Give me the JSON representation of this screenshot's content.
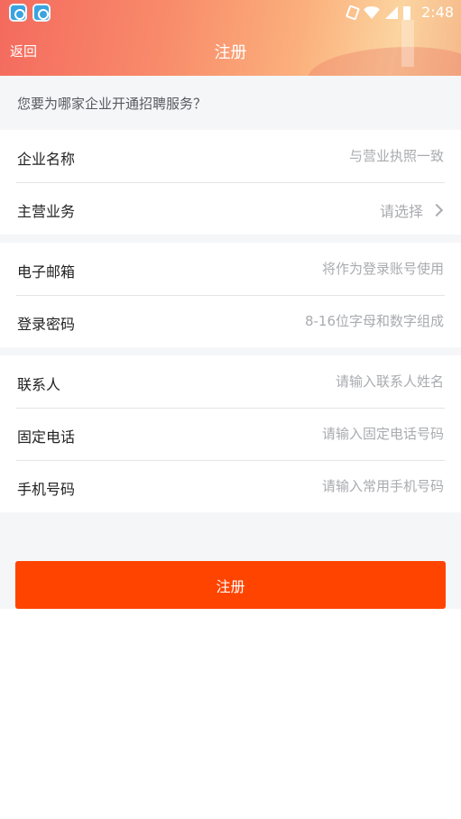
{
  "status_bar": {
    "time": "2:48",
    "icons": [
      "app-icon",
      "app-icon",
      "vibrate-icon",
      "wifi-icon",
      "signal-icon",
      "battery-charging-icon"
    ]
  },
  "header": {
    "back_label": "返回",
    "title": "注册"
  },
  "prompt": "您要为哪家企业开通招聘服务？",
  "form": {
    "company_name": {
      "label": "企业名称",
      "placeholder": "与营业执照一致"
    },
    "main_business": {
      "label": "主营业务",
      "select_text": "请选择"
    },
    "email": {
      "label": "电子邮箱",
      "placeholder": "将作为登录账号使用"
    },
    "password": {
      "label": "登录密码",
      "placeholder": "8-16位字母和数字组成"
    },
    "contact": {
      "label": "联系人",
      "placeholder": "请输入联系人姓名"
    },
    "landline": {
      "label": "固定电话",
      "placeholder": "请输入固定电话号码"
    },
    "mobile": {
      "label": "手机号码",
      "placeholder": "请输入常用手机号码"
    }
  },
  "submit_label": "注册",
  "colors": {
    "accent": "#ff4400",
    "background_gray": "#f5f6f8",
    "placeholder": "#a9abaf"
  }
}
